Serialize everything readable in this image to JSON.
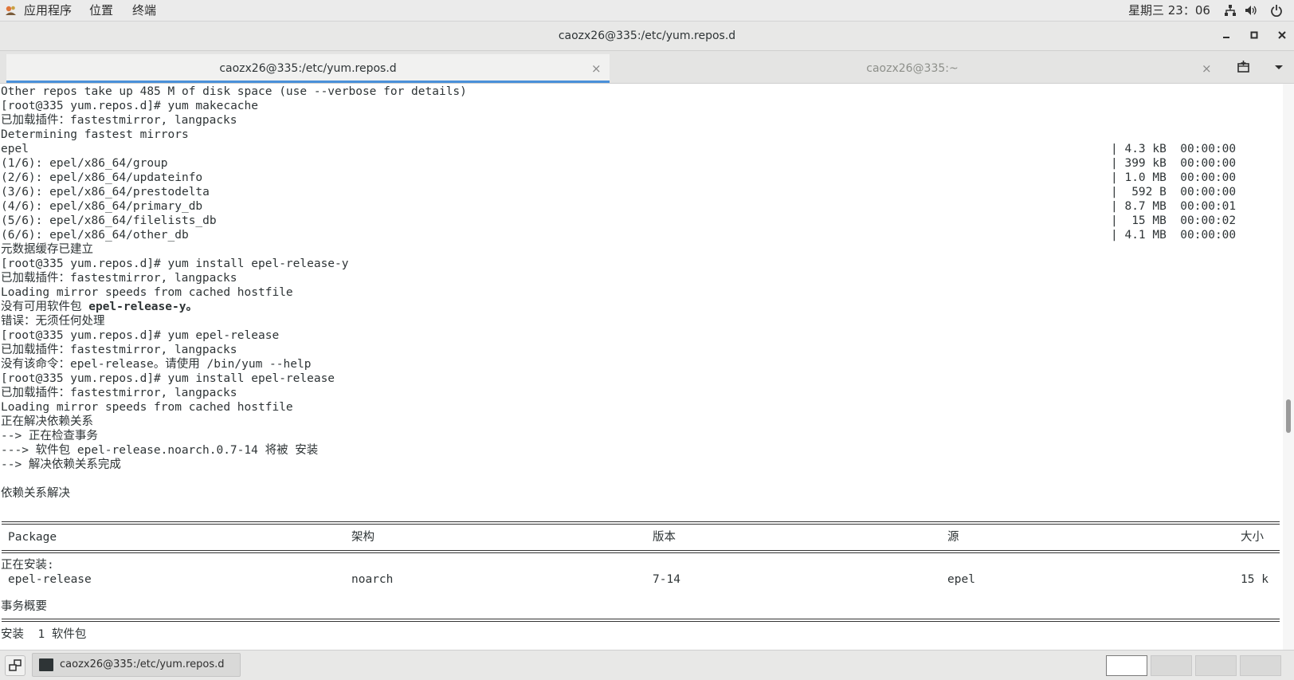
{
  "top_panel": {
    "apps_menu": "应用程序",
    "places_menu": "位置",
    "terminal_menu": "终端",
    "clock": "星期三 23：06",
    "icons": [
      "network-icon",
      "volume-icon",
      "power-icon"
    ]
  },
  "window": {
    "title": "caozx26@335:/etc/yum.repos.d",
    "buttons": [
      "minimize",
      "maximize",
      "close"
    ]
  },
  "tabs": [
    {
      "label": "caozx26@335:/etc/yum.repos.d",
      "active": true
    },
    {
      "label": "caozx26@335:~",
      "active": false
    }
  ],
  "terminal": {
    "lines": [
      "Other repos take up 485 M of disk space (use --verbose for details)",
      "[root@335 yum.repos.d]# yum makecache",
      "已加载插件：fastestmirror, langpacks",
      "Determining fastest mirrors",
      "epel",
      "(1/6): epel/x86_64/group",
      "(2/6): epel/x86_64/updateinfo",
      "(3/6): epel/x86_64/prestodelta",
      "(4/6): epel/x86_64/primary_db",
      "(5/6): epel/x86_64/filelists_db",
      "(6/6): epel/x86_64/other_db",
      "元数据缓存已建立",
      "[root@335 yum.repos.d]# yum install epel-release-y",
      "已加载插件：fastestmirror, langpacks",
      "Loading mirror speeds from cached hostfile",
      "没有可用软件包 ",
      "错误：无须任何处理",
      "[root@335 yum.repos.d]# yum epel-release",
      "已加载插件：fastestmirror, langpacks",
      "没有该命令：epel-release。请使用 /bin/yum --help",
      "[root@335 yum.repos.d]# yum install epel-release",
      "已加载插件：fastestmirror, langpacks",
      "Loading mirror speeds from cached hostfile",
      "正在解决依赖关系",
      "--> 正在检查事务",
      "---> 软件包 epel-release.noarch.0.7-14 将被 安装",
      "--> 解决依赖关系完成",
      "",
      "依赖关系解决"
    ],
    "bold_package": "epel-release-y。",
    "downloads": [
      {
        "size": "| 4.3 kB  00:00:00"
      },
      {
        "size": "| 399 kB  00:00:00"
      },
      {
        "size": "| 1.0 MB  00:00:00"
      },
      {
        "size": "|  592 B  00:00:00"
      },
      {
        "size": "| 8.7 MB  00:00:01"
      },
      {
        "size": "|  15 MB  00:00:02"
      },
      {
        "size": "| 4.1 MB  00:00:00"
      }
    ],
    "table": {
      "headers": [
        "Package",
        "架构",
        "版本",
        "源",
        "大小"
      ],
      "section": "正在安装:",
      "row": [
        "epel-release",
        "noarch",
        "7-14",
        "epel",
        "15 k"
      ]
    },
    "summary_title": "事务概要",
    "summary_line": "安装  1 软件包"
  },
  "taskbar": {
    "task_label": "caozx26@335:/etc/yum.repos.d"
  }
}
